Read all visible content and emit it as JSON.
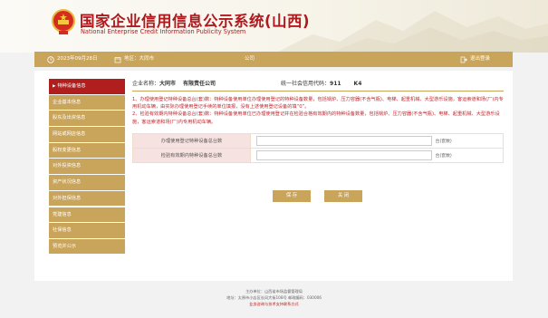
{
  "header": {
    "title": "国家企业信用信息公示系统(山西)",
    "subtitle": "National Enterprise Credit Information Publicity System"
  },
  "infobar": {
    "date": "2023年09月28日",
    "region": "地区：大同市",
    "middle": "公司",
    "logout": "退出登录"
  },
  "sidebar": {
    "items": [
      {
        "label": "特种设备信息",
        "active": true
      },
      {
        "label": "企业基本信息",
        "active": false
      },
      {
        "label": "股东及出资信息",
        "active": false
      },
      {
        "label": "网站或网店信息",
        "active": false
      },
      {
        "label": "股权变更信息",
        "active": false
      },
      {
        "label": "对外投资信息",
        "active": false
      },
      {
        "label": "资产状况信息",
        "active": false
      },
      {
        "label": "对外担保信息",
        "active": false
      },
      {
        "label": "党建信息",
        "active": false
      },
      {
        "label": "社保信息",
        "active": false
      },
      {
        "label": "预览并公示",
        "active": false
      }
    ]
  },
  "company": {
    "name_label": "企业名称：",
    "name_value": "大同市",
    "name_suffix": "有限责任公司",
    "credit_label": "统一社会信用代码：",
    "credit_value": "911",
    "credit_suffix": "K4"
  },
  "notice": {
    "line1": "1、办理使用登记特种设备总台(套)数：特种设备使用单位办理使用登记的特种设备数量，包括锅炉、压力容器(不含气瓶)、电梯、起重机械、大型游乐设施，客运索道和场(厂)内专用机动车辆，由实际办理使用登记手续的单位填报，没有上述使用登记设备的填“0”。",
    "line2": "2、检验有效期内特种设备总台(套)数：特种设备使用单位已办理使用登记并在检验合格有效期内的特种设备数量，包括锅炉、压力容器(不含气瓶)、电梯、起重机械、大型游乐设施，客运索道和场(厂)内专用机动车辆。"
  },
  "form": {
    "rows": [
      {
        "label": "办理使用登记特种设备总台数",
        "value": "",
        "unit": "台(套数)"
      },
      {
        "label": "检验有效期内特种设备总台数",
        "value": "",
        "unit": "台(套数)"
      }
    ],
    "save_label": "保 存",
    "close_label": "关 闭"
  },
  "footer": {
    "line1": "主办单位：山西省市场监督管理局",
    "line2": "地址：太原市小店区长风大街108号 邮政编码：030006",
    "line3": "业务咨询与技术支持联系方式"
  },
  "colors": {
    "brand_red": "#b01f1d",
    "gold": "#c9a45b"
  }
}
